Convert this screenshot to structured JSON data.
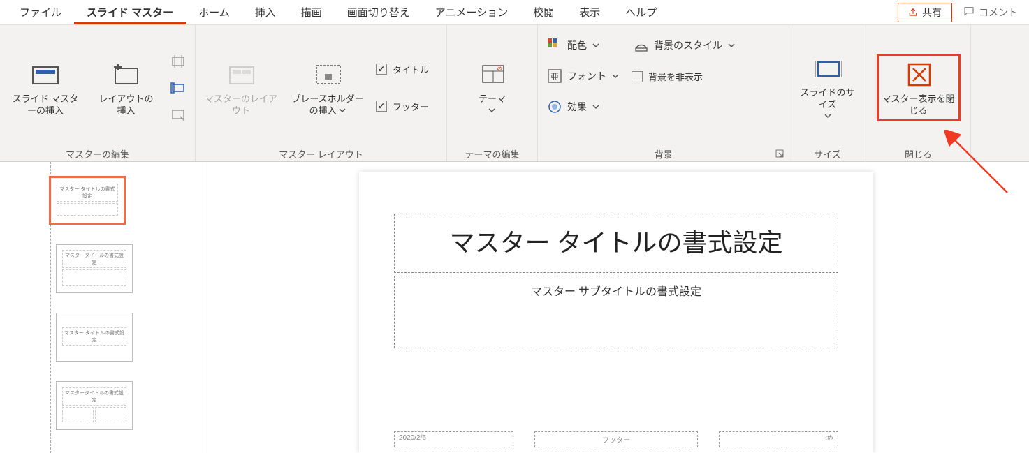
{
  "tabs": {
    "file": "ファイル",
    "slide_master": "スライド マスター",
    "home": "ホーム",
    "insert": "挿入",
    "draw": "描画",
    "transition": "画面切り替え",
    "animation": "アニメーション",
    "review": "校閲",
    "view": "表示",
    "help": "ヘルプ",
    "share": "共有",
    "comment": "コメント"
  },
  "ribbon": {
    "edit_master": {
      "insert_slide_master": "スライド マスターの挿入",
      "insert_layout": "レイアウトの挿入",
      "label": "マスターの編集"
    },
    "master_layout": {
      "master_layout_btn": "マスターのレイアウト",
      "insert_placeholder": "プレースホルダーの挿入",
      "title_cb": "タイトル",
      "footer_cb": "フッター",
      "label": "マスター レイアウト"
    },
    "theme_edit": {
      "theme_btn": "テーマ",
      "label": "テーマの編集"
    },
    "background": {
      "colors": "配色",
      "fonts": "フォント",
      "effects": "効果",
      "bg_styles": "背景のスタイル",
      "hide_bg": "背景を非表示",
      "label": "背景"
    },
    "size": {
      "slide_size": "スライドのサイズ",
      "label": "サイズ"
    },
    "close": {
      "close_master": "マスター表示を閉じる",
      "label": "閉じる"
    }
  },
  "slide": {
    "title": "マスター タイトルの書式設定",
    "subtitle": "マスター サブタイトルの書式設定",
    "footer_date": "2020/2/6",
    "footer_center": "フッター",
    "footer_num": "‹#›"
  },
  "thumbs": {
    "t1": "マスター タイトルの書式設定",
    "t2": "マスタータイトルの書式設定",
    "t3": "マスター タイトルの書式設定",
    "t4": "マスタータイトルの書式設定"
  }
}
